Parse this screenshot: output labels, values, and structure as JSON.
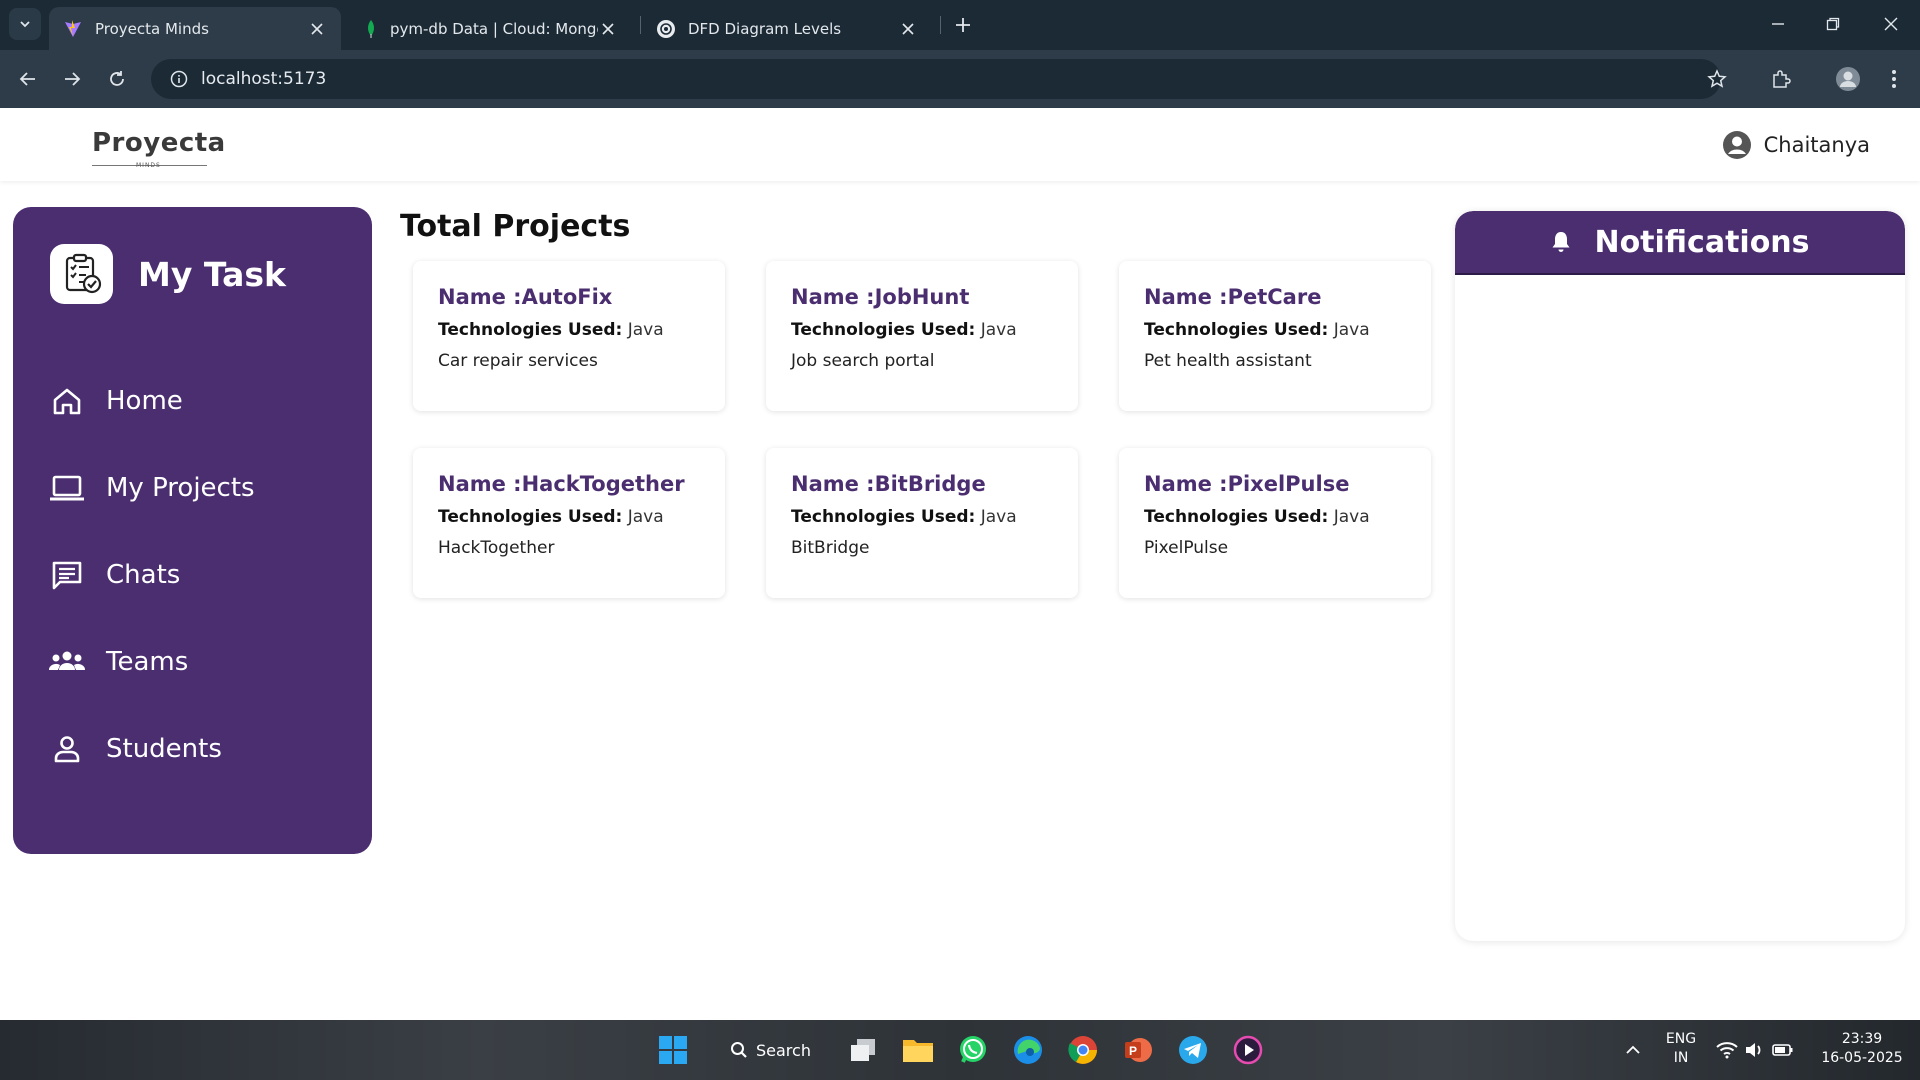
{
  "browser": {
    "tabs": [
      {
        "title": "Proyecta Minds",
        "icon": "vite-icon"
      },
      {
        "title": "pym-db Data | Cloud: MongoDB",
        "icon": "mongodb-leaf-icon"
      },
      {
        "title": "DFD Diagram Levels",
        "icon": "chatgpt-icon"
      }
    ],
    "url": "localhost:5173"
  },
  "header": {
    "logo_text": "Proyecta",
    "logo_sub": "MINDS",
    "user_name": "Chaitanya"
  },
  "sidebar": {
    "title": "My Task",
    "items": [
      {
        "label": "Home",
        "icon": "home-icon"
      },
      {
        "label": "My Projects",
        "icon": "laptop-icon"
      },
      {
        "label": "Chats",
        "icon": "chat-icon"
      },
      {
        "label": "Teams",
        "icon": "team-icon"
      },
      {
        "label": "Students",
        "icon": "user-icon"
      }
    ]
  },
  "main": {
    "title": "Total Projects",
    "tech_label": "Technologies Used:",
    "projects": [
      {
        "name": "Name :AutoFix",
        "tech": "Java",
        "desc": "Car repair services"
      },
      {
        "name": "Name :JobHunt",
        "tech": "Java",
        "desc": "Job search portal"
      },
      {
        "name": "Name :PetCare",
        "tech": "Java",
        "desc": "Pet health assistant"
      },
      {
        "name": "Name :HackTogether",
        "tech": "Java",
        "desc": "HackTogether"
      },
      {
        "name": "Name :BitBridge",
        "tech": "Java",
        "desc": "BitBridge"
      },
      {
        "name": "Name :PixelPulse",
        "tech": "Java",
        "desc": "PixelPulse"
      }
    ]
  },
  "notifications": {
    "title": "Notifications"
  },
  "taskbar": {
    "search_label": "Search",
    "lang_top": "ENG",
    "lang_bottom": "IN",
    "time": "23:39",
    "date": "16-05-2025"
  },
  "colors": {
    "brand": "#4b2e70",
    "chrome_dark": "#1c2a36",
    "chrome_toolbar": "#2e3c49"
  }
}
